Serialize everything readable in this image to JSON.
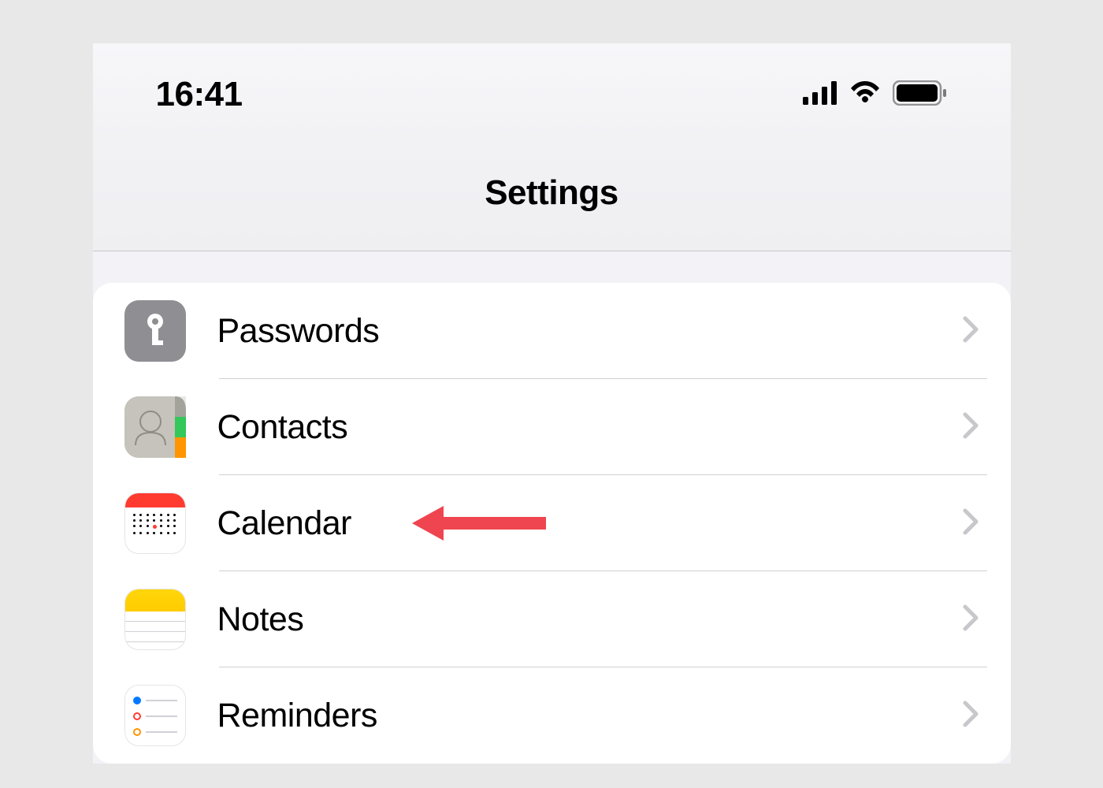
{
  "status_bar": {
    "time": "16:41"
  },
  "header": {
    "title": "Settings"
  },
  "list": {
    "items": [
      {
        "label": "Passwords",
        "icon": "passwords"
      },
      {
        "label": "Contacts",
        "icon": "contacts"
      },
      {
        "label": "Calendar",
        "icon": "calendar"
      },
      {
        "label": "Notes",
        "icon": "notes"
      },
      {
        "label": "Reminders",
        "icon": "reminders"
      }
    ]
  },
  "annotation": {
    "target_index": 2,
    "color": "#ef4550"
  }
}
